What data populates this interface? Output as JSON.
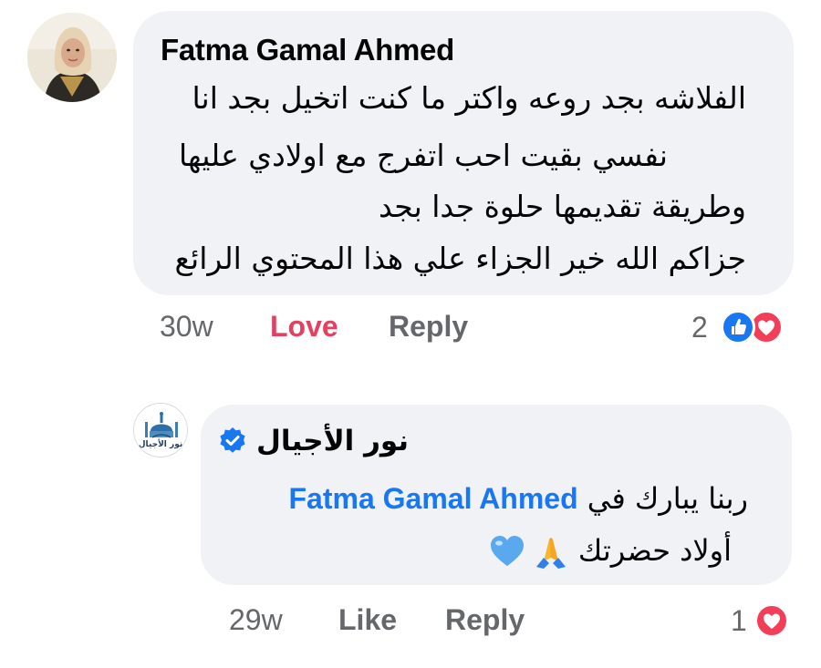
{
  "comment": {
    "author": "Fatma Gamal Ahmed",
    "lines": [
      "الفلاشه بجد روعه واكتر ما كنت اتخيل بجد انا",
      "نفسي بقيت احب اتفرج مع اولادي عليها",
      "وطريقة تقديمها حلوة جدا بجد",
      "جزاكم الله خير الجزاء علي هذا المحتوي الرائع"
    ],
    "time": "30w",
    "reaction_label": "Love",
    "reply_label": "Reply",
    "reaction_count": "2",
    "reaction_icons": [
      "like-icon",
      "love-icon"
    ],
    "colors": {
      "love": "#e4405f",
      "like": "#1877f2"
    }
  },
  "reply": {
    "author": "نور الأجيال",
    "avatar_text": "نور الأجيال",
    "verified": true,
    "mention": "Fatma Gamal Ahmed",
    "line1_text": "ربنا يبارك في",
    "line2_text": "أولاد حضرتك",
    "emojis": [
      "folded-hands-emoji",
      "blue-heart-emoji"
    ],
    "time": "29w",
    "like_label": "Like",
    "reply_label": "Reply",
    "reaction_count": "1",
    "reaction_icons": [
      "love-icon"
    ],
    "colors": {
      "mention": "#1877f2"
    }
  }
}
